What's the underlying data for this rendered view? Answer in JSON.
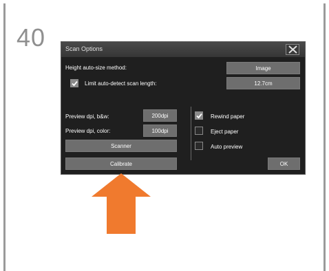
{
  "step": {
    "number": "40"
  },
  "dialog": {
    "title": "Scan Options",
    "height_method_label": "Height auto-size method:",
    "height_method_value": "Image",
    "limit_label": "Limit auto-detect scan length:",
    "limit_checked": true,
    "limit_value": "12.7cm",
    "preview_bw_label": "Preview dpi, b&w:",
    "preview_bw_value": "200dpi",
    "preview_color_label": "Preview dpi, color:",
    "preview_color_value": "100dpi",
    "scanner_label": "Scanner",
    "rewind_label": "Rewind paper",
    "rewind_checked": true,
    "eject_label": "Eject paper",
    "eject_checked": false,
    "auto_preview_label": "Auto preview",
    "auto_preview_checked": false,
    "calibrate_label": "Calibrate",
    "ok_label": "OK"
  },
  "colors": {
    "arrow": "#f07a2e",
    "frame": "#9a9a9a",
    "button": "#6e6e6e"
  },
  "icons": [
    "close-icon",
    "checkmark-icon",
    "arrow-up-icon"
  ]
}
